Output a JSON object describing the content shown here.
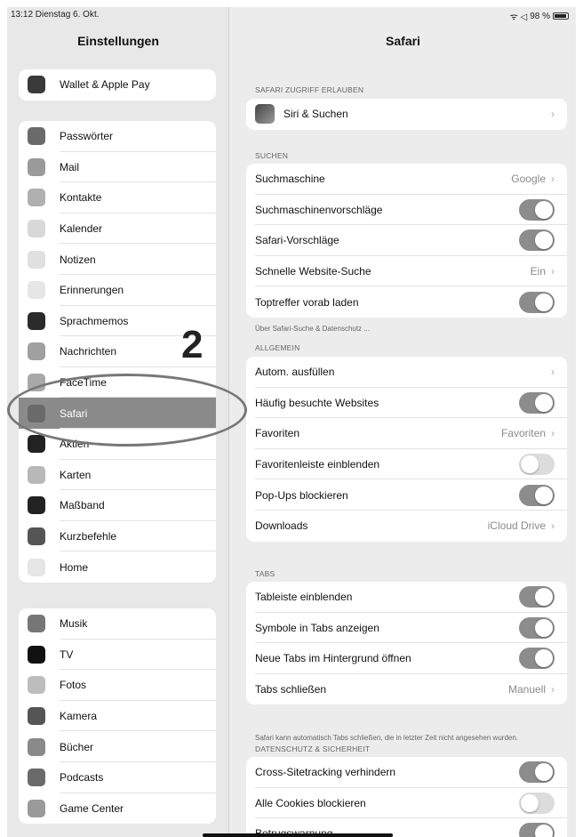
{
  "status": {
    "time_date": "13:12  Dienstag 6. Okt.",
    "battery": "98 %",
    "signal": "ᯤ ◁"
  },
  "sidebar": {
    "title": "Einstellungen",
    "groups": [
      {
        "items": [
          {
            "label": "Wallet & Apple Pay",
            "icon": "wallet-icon",
            "color": "#3a3a3a"
          }
        ]
      },
      {
        "items": [
          {
            "label": "Passwörter",
            "icon": "key-icon",
            "color": "#6a6a6a"
          },
          {
            "label": "Mail",
            "icon": "mail-icon",
            "color": "#9a9a9a"
          },
          {
            "label": "Kontakte",
            "icon": "contacts-icon",
            "color": "#b0b0b0"
          },
          {
            "label": "Kalender",
            "icon": "calendar-icon",
            "color": "#d8d8d8"
          },
          {
            "label": "Notizen",
            "icon": "notes-icon",
            "color": "#e0e0e0"
          },
          {
            "label": "Erinnerungen",
            "icon": "reminders-icon",
            "color": "#e6e6e6"
          },
          {
            "label": "Sprachmemos",
            "icon": "voice-memo-icon",
            "color": "#2a2a2a"
          },
          {
            "label": "Nachrichten",
            "icon": "messages-icon",
            "color": "#a0a0a0"
          },
          {
            "label": "FaceTime",
            "icon": "facetime-icon",
            "color": "#a8a8a8"
          },
          {
            "label": "Safari",
            "icon": "safari-icon",
            "color": "#6a6a6a"
          },
          {
            "label": "Aktien",
            "icon": "stocks-icon",
            "color": "#222222"
          },
          {
            "label": "Karten",
            "icon": "maps-icon",
            "color": "#b8b8b8"
          },
          {
            "label": "Maßband",
            "icon": "measure-icon",
            "color": "#222222"
          },
          {
            "label": "Kurzbefehle",
            "icon": "shortcuts-icon",
            "color": "#555555"
          },
          {
            "label": "Home",
            "icon": "home-icon",
            "color": "#e6e6e6"
          }
        ]
      },
      {
        "items": [
          {
            "label": "Musik",
            "icon": "music-icon",
            "color": "#777777"
          },
          {
            "label": "TV",
            "icon": "tv-icon",
            "color": "#111111"
          },
          {
            "label": "Fotos",
            "icon": "photos-icon",
            "color": "#bdbdbd"
          },
          {
            "label": "Kamera",
            "icon": "camera-icon",
            "color": "#555555"
          },
          {
            "label": "Bücher",
            "icon": "books-icon",
            "color": "#8a8a8a"
          },
          {
            "label": "Podcasts",
            "icon": "podcasts-icon",
            "color": "#6a6a6a"
          },
          {
            "label": "Game Center",
            "icon": "game-center-icon",
            "color": "#9a9a9a"
          }
        ]
      }
    ]
  },
  "annotation": {
    "number": "2"
  },
  "main": {
    "title": "Safari",
    "sections": [
      {
        "header": "SAFARI ZUGRIFF ERLAUBEN",
        "rows": [
          {
            "label": "Siri & Suchen",
            "type": "nav",
            "value": ""
          }
        ]
      },
      {
        "header": "SUCHEN",
        "rows": [
          {
            "label": "Suchmaschine",
            "type": "nav",
            "value": "Google"
          },
          {
            "label": "Suchmaschinenvorschläge",
            "type": "toggle",
            "on": true
          },
          {
            "label": "Safari-Vorschläge",
            "type": "toggle",
            "on": true
          },
          {
            "label": "Schnelle Website-Suche",
            "type": "nav",
            "value": "Ein"
          },
          {
            "label": "Toptreffer vorab laden",
            "type": "toggle",
            "on": true
          }
        ],
        "footer": "Über Safari-Suche & Datenschutz ..."
      },
      {
        "header": "ALLGEMEIN",
        "rows": [
          {
            "label": "Autom. ausfüllen",
            "type": "nav",
            "value": ""
          },
          {
            "label": "Häufig besuchte Websites",
            "type": "toggle",
            "on": true
          },
          {
            "label": "Favoriten",
            "type": "nav",
            "value": "Favoriten"
          },
          {
            "label": "Favoritenleiste einblenden",
            "type": "toggle",
            "on": false
          },
          {
            "label": "Pop-Ups blockieren",
            "type": "toggle",
            "on": true
          },
          {
            "label": "Downloads",
            "type": "nav",
            "value": "iCloud Drive"
          }
        ]
      },
      {
        "header": "TABS",
        "rows": [
          {
            "label": "Tableiste einblenden",
            "type": "toggle",
            "on": true
          },
          {
            "label": "Symbole in Tabs anzeigen",
            "type": "toggle",
            "on": true
          },
          {
            "label": "Neue Tabs im Hintergrund öffnen",
            "type": "toggle",
            "on": true
          },
          {
            "label": "Tabs schließen",
            "type": "nav",
            "value": "Manuell"
          }
        ],
        "footer": "Safari kann automatisch Tabs schließen, die in letzter Zeit nicht angesehen wurden."
      },
      {
        "header": "DATENSCHUTZ & SICHERHEIT",
        "rows": [
          {
            "label": "Cross-Sitetracking verhindern",
            "type": "toggle",
            "on": true
          },
          {
            "label": "Alle Cookies blockieren",
            "type": "toggle",
            "on": false
          },
          {
            "label": "Betrugswarnung",
            "type": "toggle",
            "on": true
          }
        ]
      }
    ]
  }
}
